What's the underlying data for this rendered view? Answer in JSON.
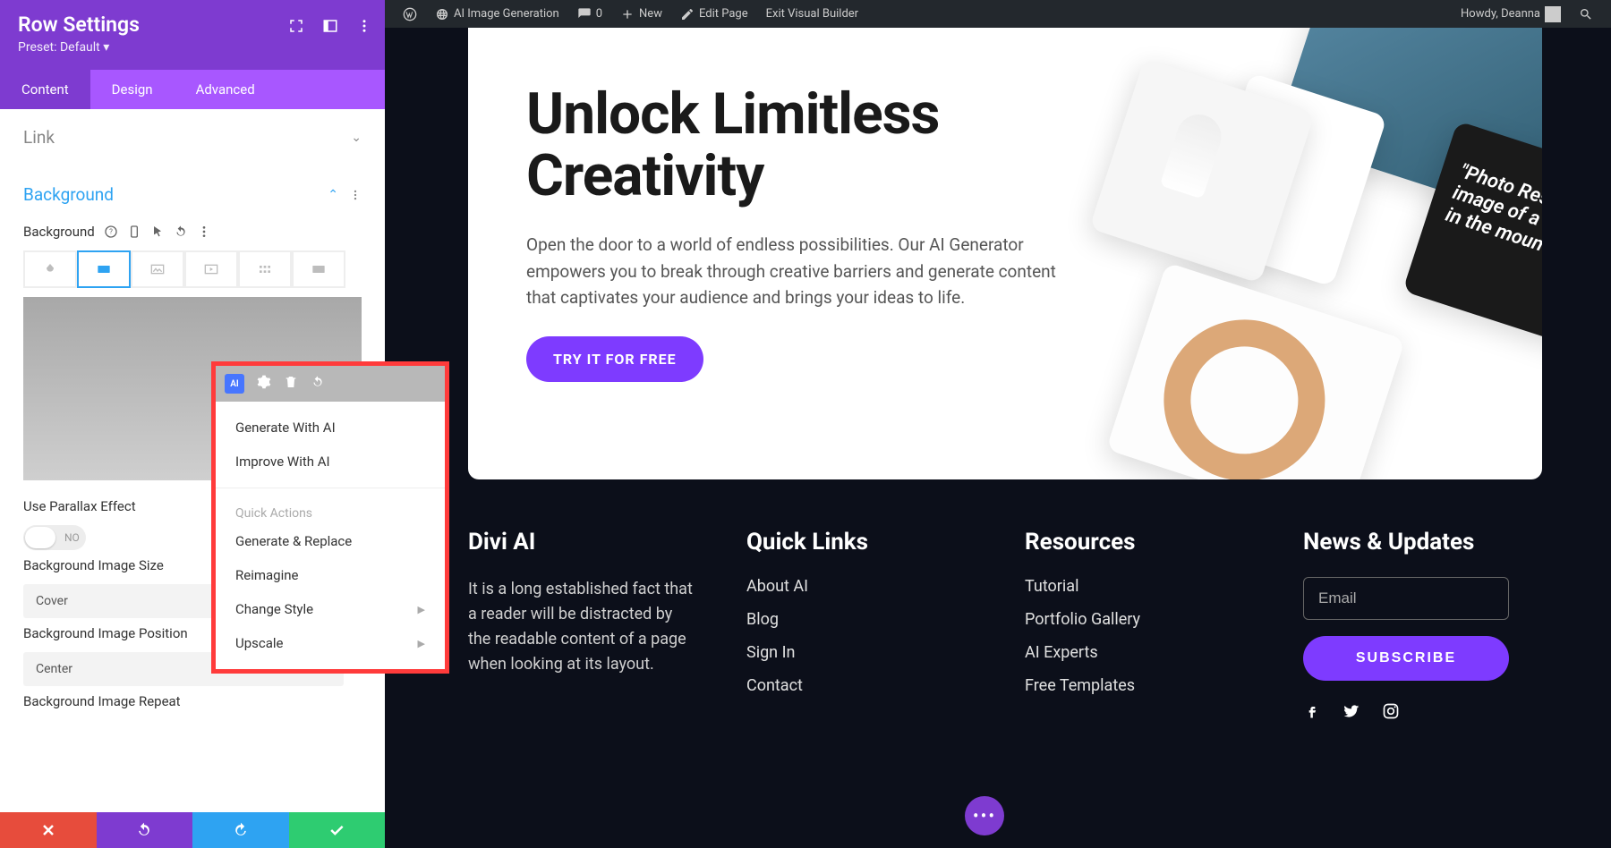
{
  "admin_bar": {
    "site_title": "AI Image Generation",
    "comments_count": "0",
    "new_label": "New",
    "edit_page_label": "Edit Page",
    "exit_vb_label": "Exit Visual Builder",
    "howdy_text": "Howdy, Deanna"
  },
  "sidebar": {
    "title": "Row Settings",
    "preset_label": "Preset: Default",
    "tabs": {
      "content": "Content",
      "design": "Design",
      "advanced": "Advanced"
    },
    "link_section": "Link",
    "background_section": "Background",
    "bg_label": "Background",
    "parallax_label": "Use Parallax Effect",
    "parallax_value": "NO",
    "bg_size_label": "Background Image Size",
    "bg_size_value": "Cover",
    "bg_pos_label": "Background Image Position",
    "bg_pos_value": "Center",
    "bg_repeat_label": "Background Image Repeat"
  },
  "ai_menu": {
    "badge": "AI",
    "generate": "Generate With AI",
    "improve": "Improve With AI",
    "quick_actions_heading": "Quick Actions",
    "generate_replace": "Generate & Replace",
    "reimagine": "Reimagine",
    "change_style": "Change Style",
    "upscale": "Upscale"
  },
  "hero": {
    "title_line1": "Unlock Limitless",
    "title_line2": "Creativity",
    "description": "Open the door to a world of endless possibilities. Our AI Generator empowers you to break through creative barriers and generate content that captivates your audience and brings your ideas to life.",
    "cta_label": "TRY IT FOR FREE",
    "card_quote": "\"Photo Reslistic image of a lake in the mountain"
  },
  "footer": {
    "col1_title": "Divi AI",
    "col1_text": "It is a long established fact that a reader will be distracted by the readable content of a page when looking at its layout.",
    "col2_title": "Quick Links",
    "col2_items": [
      "About AI",
      "Blog",
      "Sign In",
      "Contact"
    ],
    "col3_title": "Resources",
    "col3_items": [
      "Tutorial",
      "Portfolio Gallery",
      "AI Experts",
      "Free Templates"
    ],
    "col4_title": "News & Updates",
    "email_placeholder": "Email",
    "subscribe_label": "SUBSCRIBE"
  }
}
